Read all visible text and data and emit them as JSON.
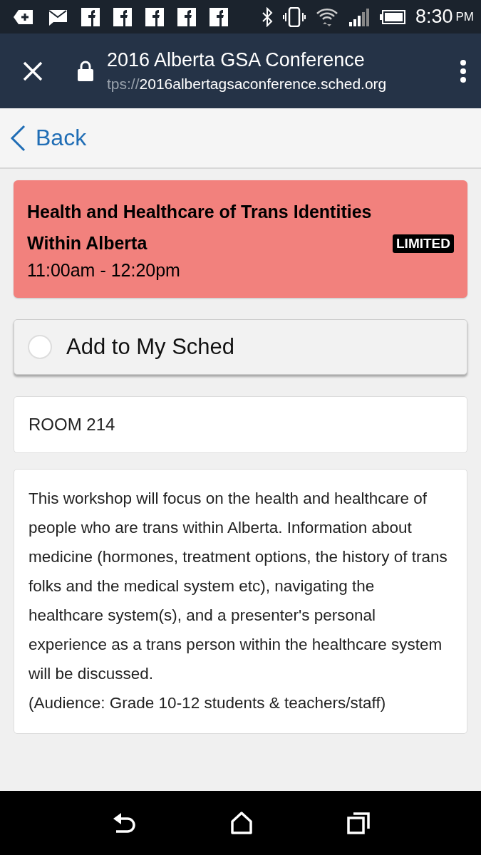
{
  "status_bar": {
    "time": "8:30",
    "ampm": "PM",
    "notification_icons": [
      {
        "kind": "add"
      },
      {
        "kind": "mail"
      },
      {
        "kind": "facebook"
      },
      {
        "kind": "facebook"
      },
      {
        "kind": "facebook"
      },
      {
        "kind": "facebook"
      },
      {
        "kind": "facebook"
      }
    ]
  },
  "browser": {
    "title": "2016 Alberta GSA Conference",
    "url_scheme": "tps://",
    "url_host": "2016albertagsaconference.sched.org"
  },
  "nav": {
    "back": "Back"
  },
  "session": {
    "title": "Health and Healthcare of Trans Identities Within Alberta",
    "badge": "LIMITED",
    "time": "11:00am - 12:20pm",
    "color": "#f2817d"
  },
  "add_button": {
    "label": "Add to My Sched",
    "checked": false
  },
  "room": "ROOM 214",
  "description": [
    "This workshop will focus on the health and healthcare of people who are trans within Alberta. Information about medicine (hormones, treatment options, the history of trans folks and the medical system etc), navigating the healthcare system(s), and a presenter's personal experience as a trans person within the healthcare system will be discussed.",
    "(Audience: Grade 10-12 students & teachers/staff)"
  ]
}
